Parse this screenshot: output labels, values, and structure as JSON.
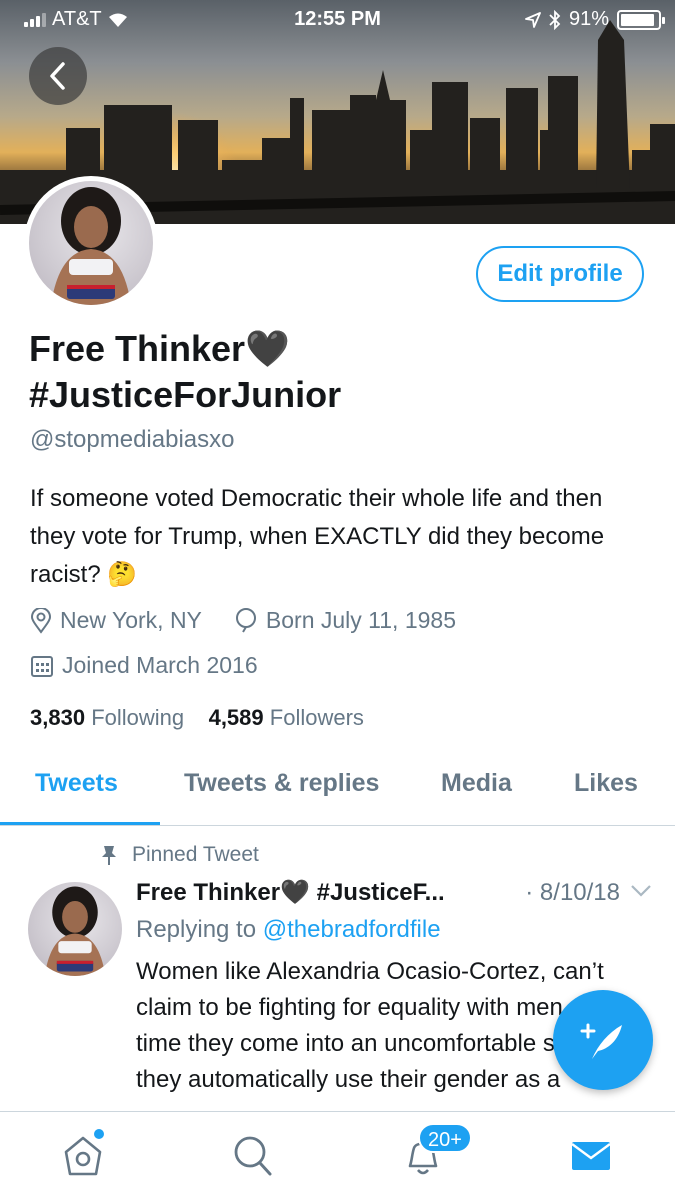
{
  "status_bar": {
    "carrier": "AT&T",
    "time": "12:55 PM",
    "battery": "91%",
    "battery_level": 0.91
  },
  "header": {
    "back_icon": "chevron-left-icon"
  },
  "profile": {
    "edit_label": "Edit profile",
    "name_line1": "Free Thinker🖤",
    "name_line2": "#JusticeForJunior",
    "handle": "@stopmediabiasxo",
    "bio": "If someone voted Democratic their whole life and then they vote for Trump, when EXACTLY did they become racist? 🤔",
    "location": "New York, NY",
    "birthday": "Born July 11, 1985",
    "joined": "Joined March 2016",
    "following_count": "3,830",
    "following_label": "Following",
    "followers_count": "4,589",
    "followers_label": "Followers"
  },
  "tabs": [
    {
      "label": "Tweets",
      "active": true
    },
    {
      "label": "Tweets & replies",
      "active": false
    },
    {
      "label": "Media",
      "active": false
    },
    {
      "label": "Likes",
      "active": false
    }
  ],
  "tweet": {
    "pinned_label": "Pinned Tweet",
    "author": "Free Thinker🖤 #JusticeF...",
    "date": "· 8/10/18",
    "replying_prefix": "Replying to",
    "replying_to": "@thebradfordfile",
    "text": "Women like Alexandria Ocasio-Cortez, can’t claim to be fighting for equality with men, if any time they come into an uncomfortable situation, they automatically use their gender as a"
  },
  "bottom_nav": {
    "notifications_badge": "20+",
    "items": [
      "home-icon",
      "search-icon",
      "notifications-icon",
      "messages-icon"
    ]
  },
  "colors": {
    "accent": "#1da1f2",
    "secondary_text": "#657786",
    "primary_text": "#14171a"
  }
}
